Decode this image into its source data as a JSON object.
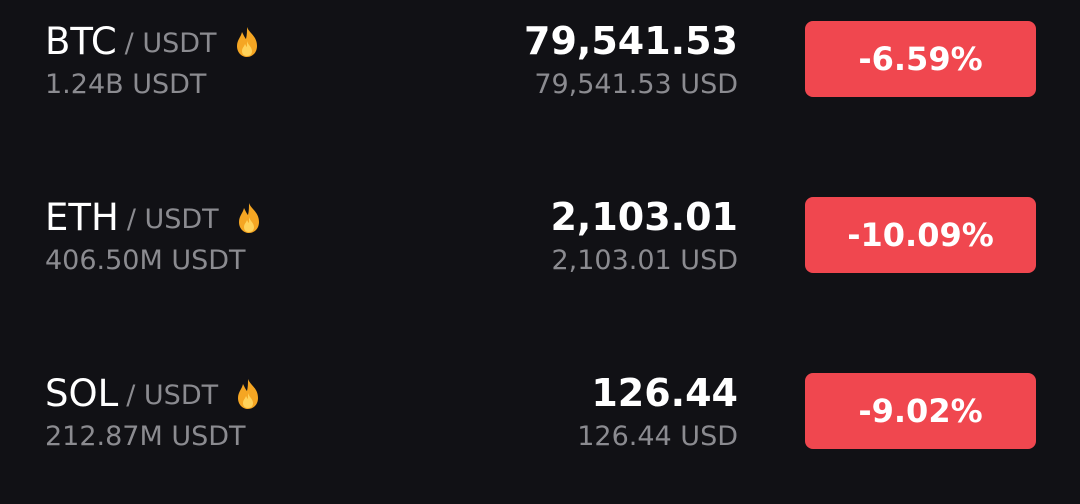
{
  "colors": {
    "background": "#111115",
    "primary_text": "#ffffff",
    "secondary_text": "#8b8b90",
    "negative": "#f0474f",
    "fire": "#f5a623"
  },
  "markets": [
    {
      "base": "BTC",
      "quote": "/ USDT",
      "hot_icon": "fire-icon",
      "volume": "1.24B USDT",
      "price": "79,541.53",
      "fiat_price": "79,541.53 USD",
      "change": "-6.59%"
    },
    {
      "base": "ETH",
      "quote": "/ USDT",
      "hot_icon": "fire-icon",
      "volume": "406.50M USDT",
      "price": "2,103.01",
      "fiat_price": "2,103.01 USD",
      "change": "-10.09%"
    },
    {
      "base": "SOL",
      "quote": "/ USDT",
      "hot_icon": "fire-icon",
      "volume": "212.87M USDT",
      "price": "126.44",
      "fiat_price": "126.44 USD",
      "change": "-9.02%"
    }
  ]
}
